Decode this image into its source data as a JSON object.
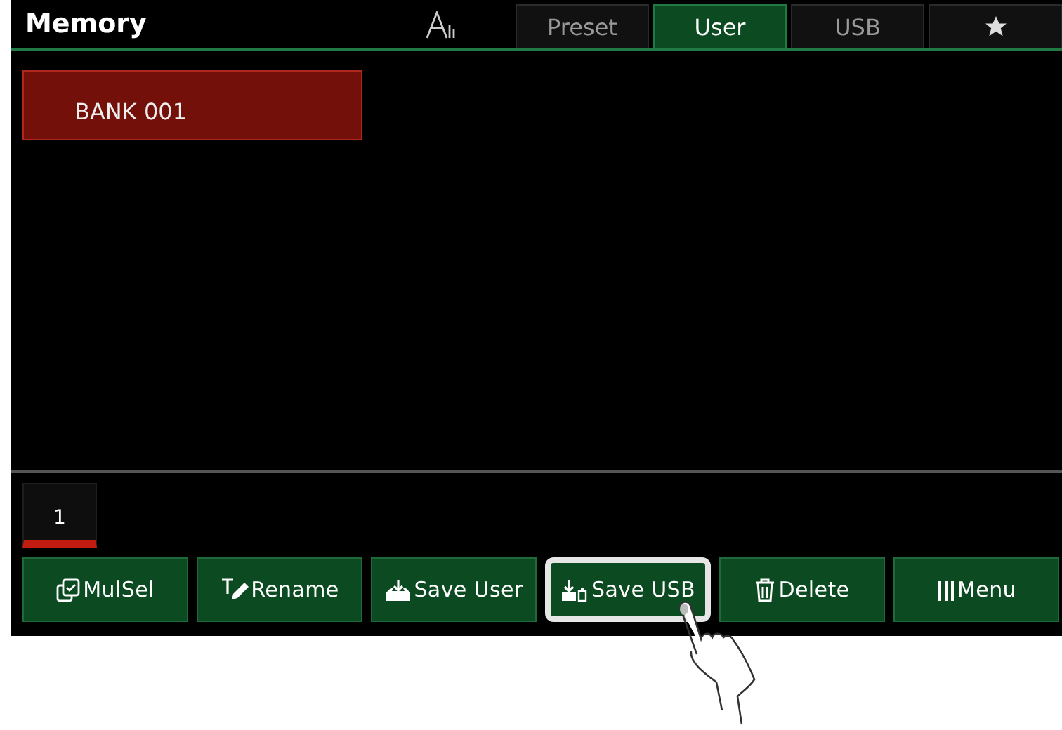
{
  "header": {
    "title": "Memory"
  },
  "tabs": [
    {
      "kind": "text",
      "label": "Preset",
      "selected": false
    },
    {
      "kind": "text",
      "label": "User",
      "selected": true
    },
    {
      "kind": "text",
      "label": "USB",
      "selected": false
    },
    {
      "kind": "star",
      "selected": false
    }
  ],
  "banks": [
    {
      "label": "BANK 001",
      "selected": true
    }
  ],
  "pages": [
    {
      "label": "1",
      "selected": true
    }
  ],
  "buttons": [
    {
      "kind": "multi",
      "label": "MulSel",
      "highlighted": false
    },
    {
      "kind": "rename",
      "label": "Rename",
      "highlighted": false
    },
    {
      "kind": "save-user",
      "label": "Save User",
      "highlighted": false
    },
    {
      "kind": "save-usb",
      "label": "Save USB",
      "highlighted": true
    },
    {
      "kind": "delete",
      "label": "Delete",
      "highlighted": false
    },
    {
      "kind": "menu",
      "label": "Menu",
      "highlighted": false
    }
  ]
}
